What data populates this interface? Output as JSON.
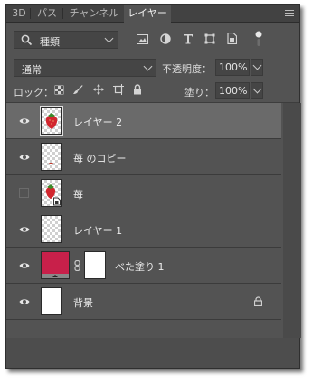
{
  "tabs": [
    {
      "label": "3D",
      "active": false
    },
    {
      "label": "パス",
      "active": false
    },
    {
      "label": "チャンネル",
      "active": false
    },
    {
      "label": "レイヤー",
      "active": true
    }
  ],
  "filter": {
    "kind_label": "種類",
    "icons": [
      "image-filter-icon",
      "adjustment-filter-icon",
      "type-filter-icon",
      "shape-filter-icon",
      "smart-object-filter-icon"
    ]
  },
  "blend": {
    "mode": "通常",
    "opacity_label": "不透明度：",
    "opacity_value": "100%"
  },
  "lock": {
    "label": "ロック：",
    "fill_label": "塗り：",
    "fill_value": "100%"
  },
  "layers": [
    {
      "name": "レイヤー 2",
      "visible": true,
      "selected": true,
      "thumb": "strawberry"
    },
    {
      "name": "苺 のコピー",
      "visible": true,
      "selected": false,
      "thumb": "transparent-bit"
    },
    {
      "name": "苺",
      "visible": false,
      "selected": false,
      "thumb": "strawberry-smart"
    },
    {
      "name": "レイヤー 1",
      "visible": true,
      "selected": false,
      "thumb": "transparent"
    },
    {
      "name": "べた塗り 1",
      "visible": true,
      "selected": false,
      "thumb": "fill",
      "fill_color": "#c8204a"
    },
    {
      "name": "背景",
      "visible": true,
      "selected": false,
      "thumb": "white",
      "locked": true
    }
  ],
  "colors": {
    "panel": "#535353",
    "selected_row": "#6a6a6a",
    "fill_swatch": "#c8204a"
  }
}
